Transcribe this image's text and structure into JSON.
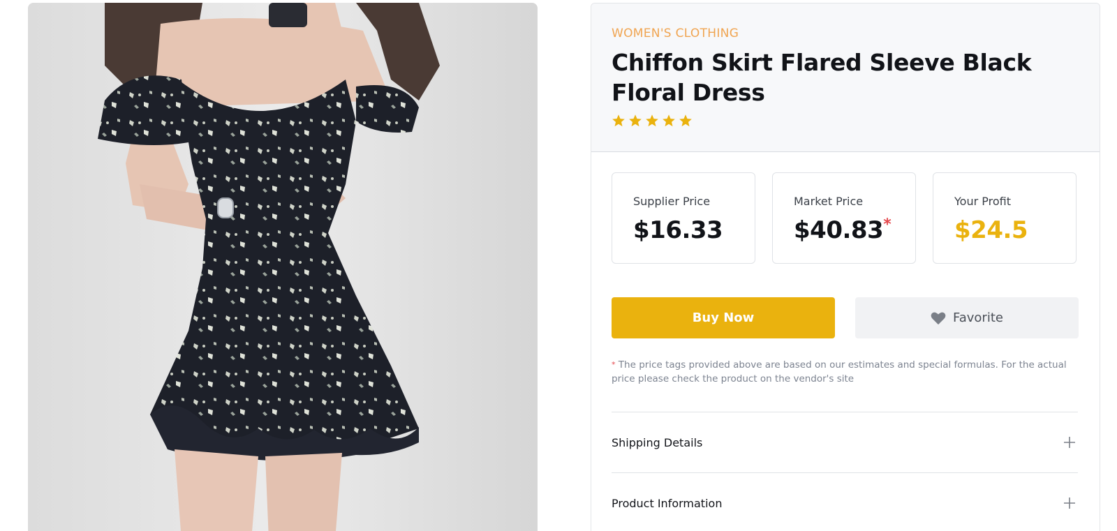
{
  "product": {
    "category": "WOMEN'S CLOTHING",
    "title": "Chiffon Skirt Flared Sleeve Black Floral Dress",
    "rating": 5,
    "image_icon": "product-photo-dress"
  },
  "prices": [
    {
      "label": "Supplier Price",
      "value": "$16.33",
      "asterisk": ""
    },
    {
      "label": "Market Price",
      "value": "$40.83",
      "asterisk": "*"
    },
    {
      "label": "Your Profit",
      "value": "$24.5",
      "asterisk": ""
    }
  ],
  "actions": {
    "buy_label": "Buy Now",
    "favorite_label": "Favorite"
  },
  "disclaimer": {
    "mark": "*",
    "text": "The price tags provided above are based on our estimates and special formulas. For the actual price please check the product on the vendor's site"
  },
  "accordion": [
    {
      "label": "Shipping Details"
    },
    {
      "label": "Product Information"
    }
  ],
  "colors": {
    "accent": "#eab20e",
    "category": "#f0a450",
    "asterisk": "#e5484d"
  }
}
